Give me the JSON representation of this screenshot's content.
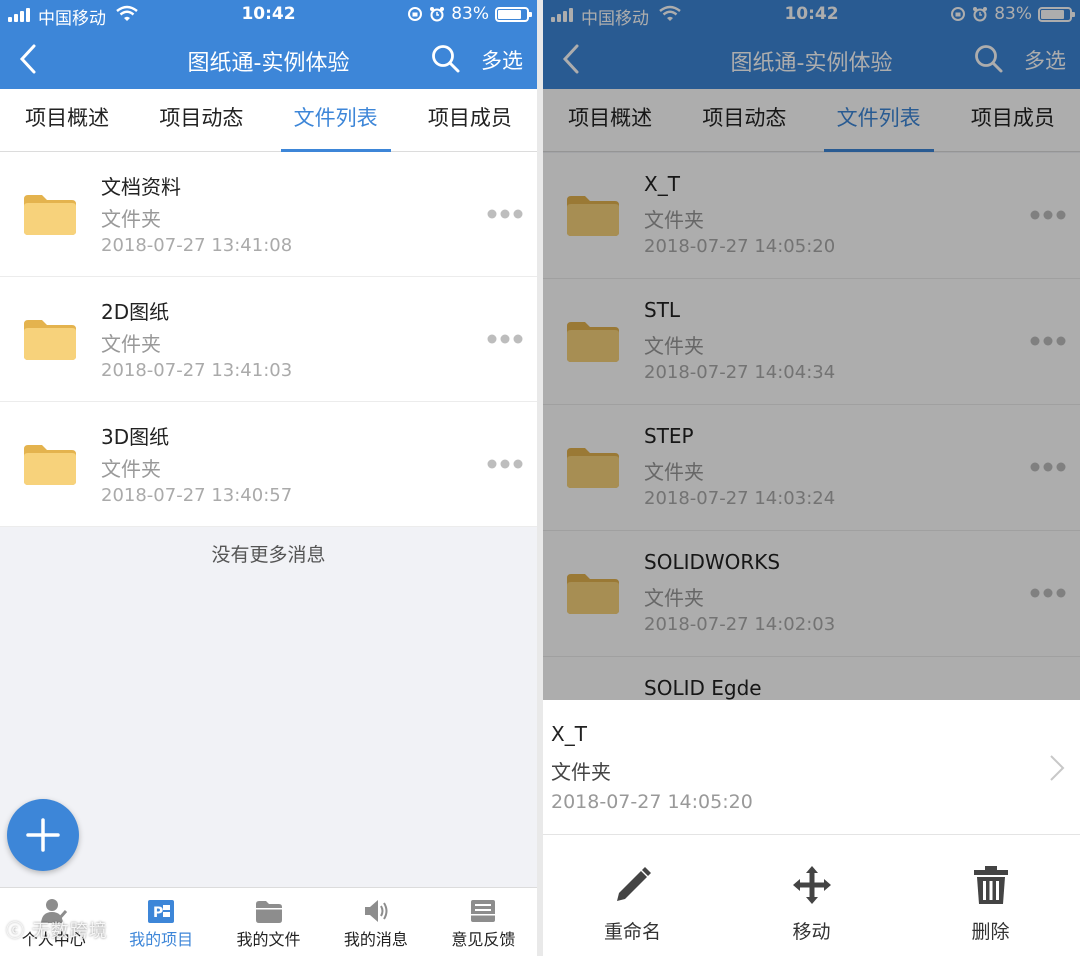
{
  "left": {
    "status": {
      "carrier": "中国移动",
      "time": "10:42",
      "battery": "83%"
    },
    "nav": {
      "title": "图纸通-实例体验",
      "multi_select": "多选"
    },
    "tabs": [
      {
        "label": "项目概述"
      },
      {
        "label": "项目动态"
      },
      {
        "label": "文件列表"
      },
      {
        "label": "项目成员"
      }
    ],
    "active_tab": "文件列表",
    "files": [
      {
        "name": "文档资料",
        "type": "文件夹",
        "date": "2018-07-27 13:41:08"
      },
      {
        "name": "2D图纸",
        "type": "文件夹",
        "date": "2018-07-27 13:41:03"
      },
      {
        "name": "3D图纸",
        "type": "文件夹",
        "date": "2018-07-27 13:40:57"
      }
    ],
    "no_more": "没有更多消息",
    "bottom_nav": [
      {
        "label": "个人中心",
        "icon": "person-icon"
      },
      {
        "label": "我的项目",
        "icon": "project-icon"
      },
      {
        "label": "我的文件",
        "icon": "folder-icon"
      },
      {
        "label": "我的消息",
        "icon": "speaker-icon"
      },
      {
        "label": "意见反馈",
        "icon": "feedback-icon"
      }
    ],
    "active_bottom": "我的项目",
    "watermark": "ⓒ 无数跨境"
  },
  "right": {
    "status": {
      "carrier": "中国移动",
      "time": "10:42",
      "battery": "83%"
    },
    "nav": {
      "title": "图纸通-实例体验",
      "multi_select": "多选"
    },
    "tabs": [
      {
        "label": "项目概述"
      },
      {
        "label": "项目动态"
      },
      {
        "label": "文件列表"
      },
      {
        "label": "项目成员"
      }
    ],
    "files": [
      {
        "name": "X_T",
        "type": "文件夹",
        "date": "2018-07-27 14:05:20"
      },
      {
        "name": "STL",
        "type": "文件夹",
        "date": "2018-07-27 14:04:34"
      },
      {
        "name": "STEP",
        "type": "文件夹",
        "date": "2018-07-27 14:03:24"
      },
      {
        "name": "SOLIDWORKS",
        "type": "文件夹",
        "date": "2018-07-27 14:02:03"
      },
      {
        "name": "SOLID Egde",
        "type": "",
        "date": ""
      }
    ],
    "sheet": {
      "name": "X_T",
      "type": "文件夹",
      "date": "2018-07-27 14:05:20",
      "actions": [
        {
          "label": "重命名",
          "icon": "pencil-icon"
        },
        {
          "label": "移动",
          "icon": "move-icon"
        },
        {
          "label": "删除",
          "icon": "trash-icon"
        }
      ]
    }
  },
  "colors": {
    "primary": "#3d86d8",
    "folder": "#f2c866",
    "background": "#f1f2f6"
  }
}
